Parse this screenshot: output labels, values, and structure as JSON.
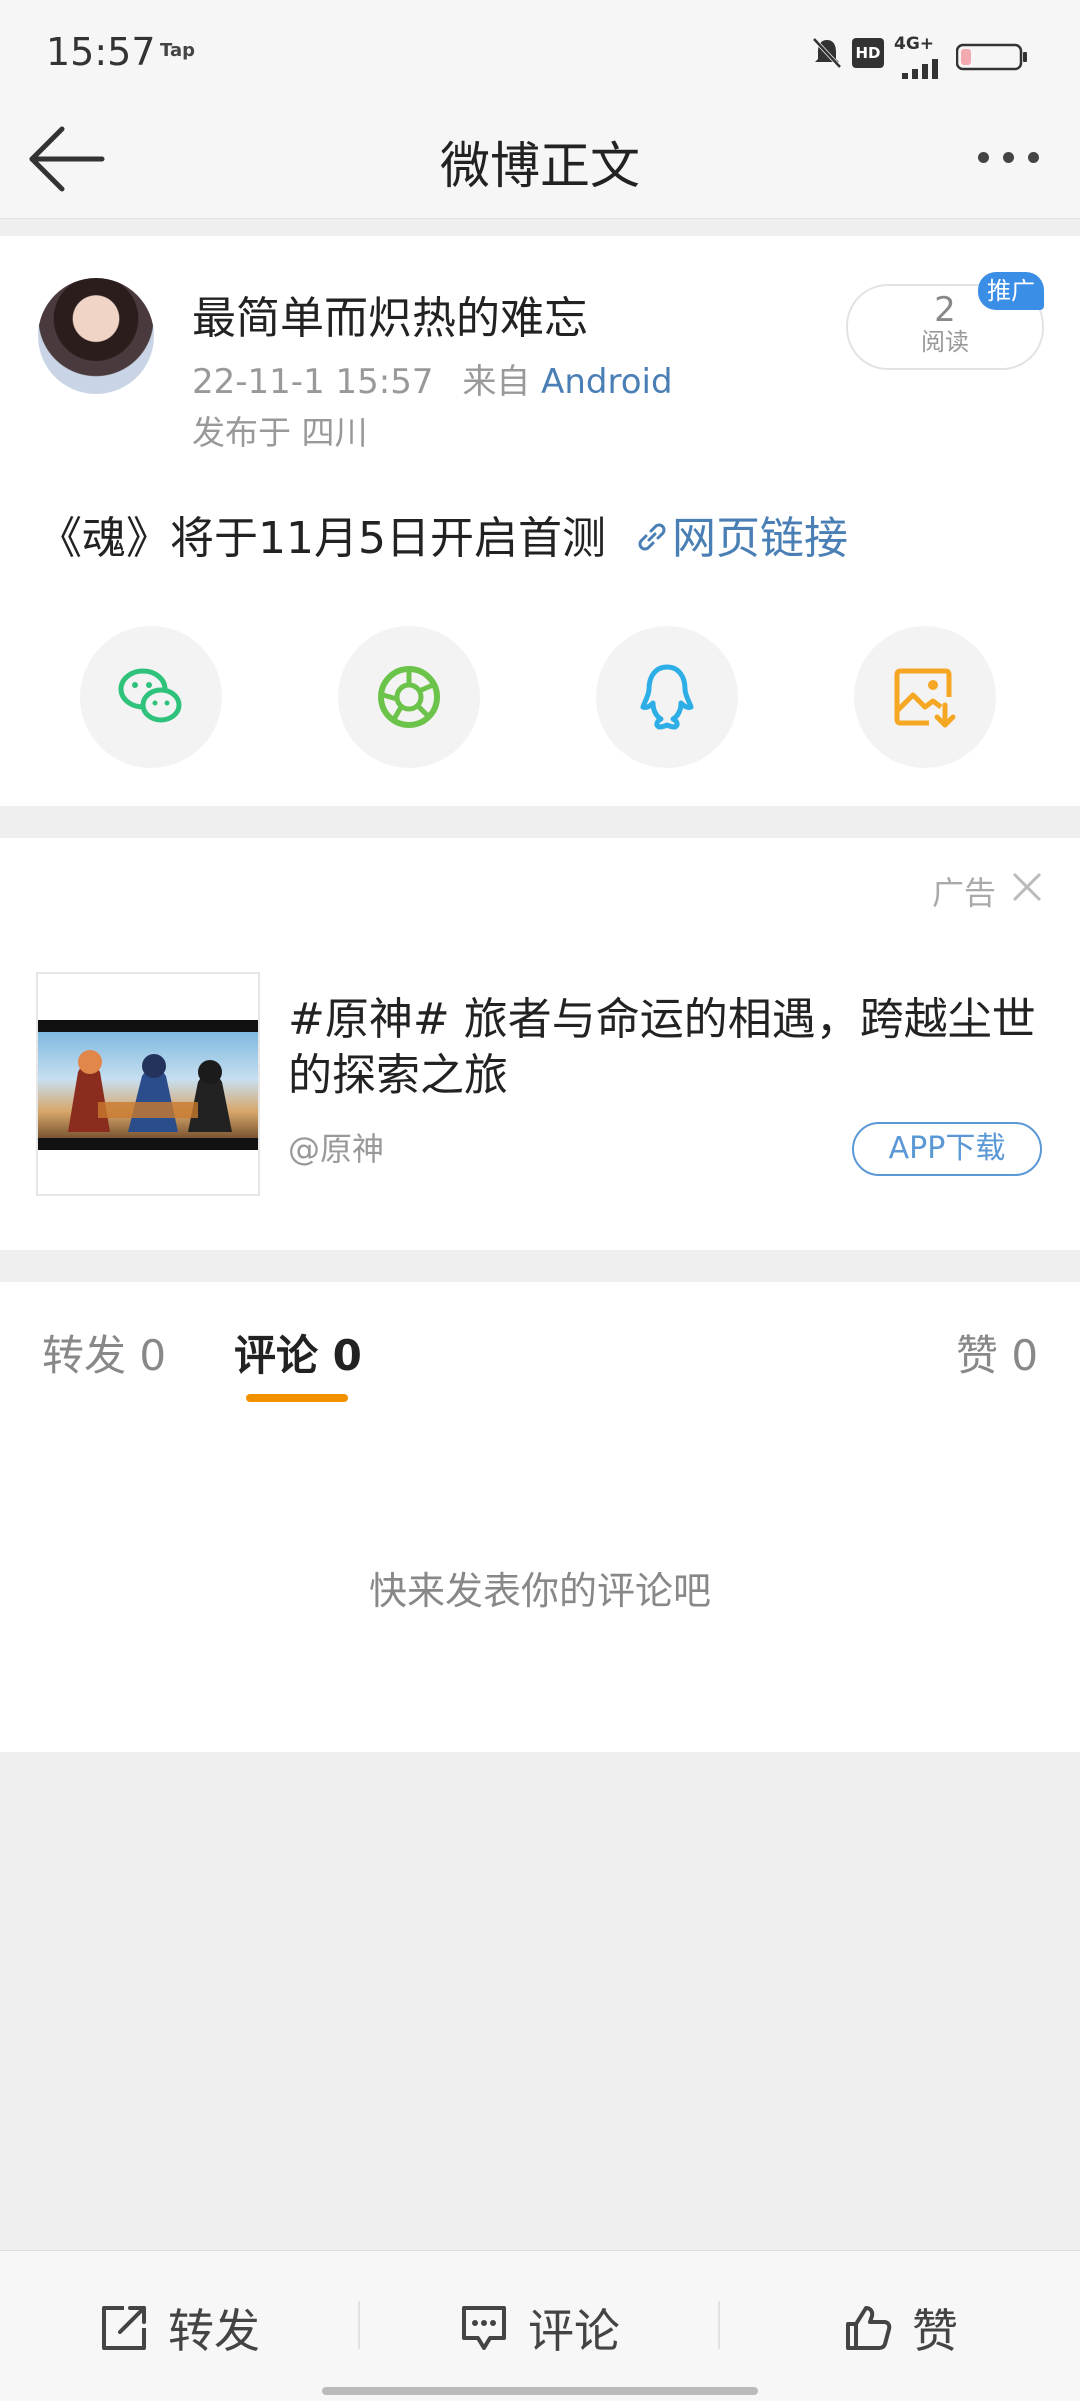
{
  "status_bar": {
    "time": "15:57",
    "app_indicator": "Tap",
    "icons": [
      "bell-muted-icon",
      "hd-icon",
      "4g-signal-icon",
      "battery-low-icon"
    ],
    "network": "4G+",
    "hd": "HD"
  },
  "nav": {
    "title": "微博正文",
    "back_icon": "back-arrow-icon",
    "more_icon": "more-dots-icon"
  },
  "post": {
    "username": "最简单而炽热的难忘",
    "date": "22-11-1 15:57",
    "source_prefix": "来自",
    "source": "Android",
    "location": "发布于 四川",
    "read_count": "2",
    "read_label": "阅读",
    "promo_badge": "推广",
    "content_text": "《魂》将于11月5日开启首测",
    "link_text": "网页链接",
    "share_icons": [
      "wechat-icon",
      "moments-icon",
      "qq-icon",
      "save-image-icon"
    ]
  },
  "ad": {
    "tag": "广告",
    "title": "#原神# 旅者与命运的相遇，跨越尘世的探索之旅",
    "source": "@原神",
    "button": "APP下载"
  },
  "tabs": {
    "repost": "转发 0",
    "comment": "评论 0",
    "like": "赞 0",
    "active": "评论"
  },
  "comments": {
    "empty_text": "快来发表你的评论吧"
  },
  "bottom_bar": {
    "repost": "转发",
    "comment": "评论",
    "like": "赞"
  },
  "colors": {
    "accent": "#f29100",
    "link": "#4a7fb5",
    "promo": "#3b8ee6"
  }
}
